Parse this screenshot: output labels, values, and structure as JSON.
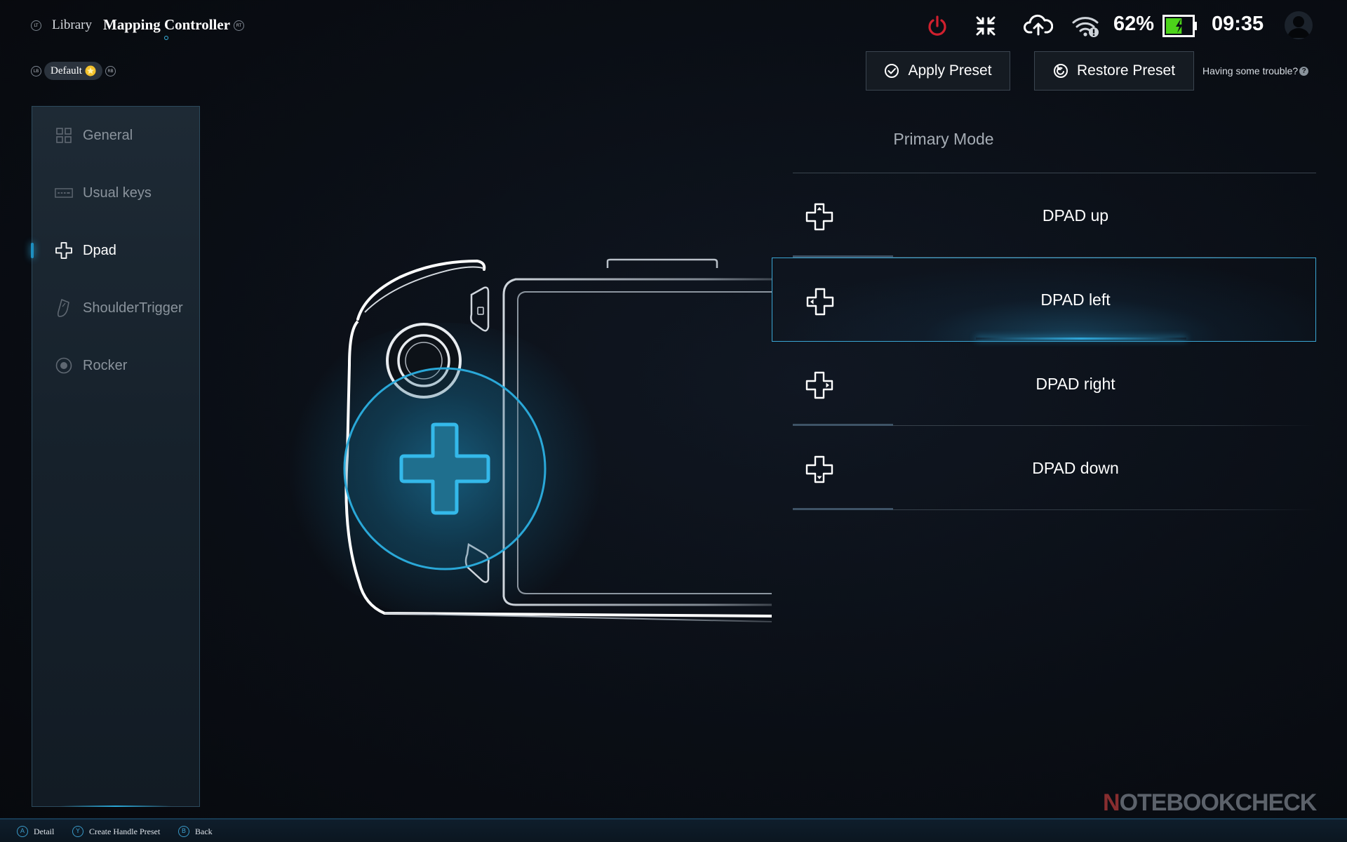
{
  "header": {
    "lt_badge": "LT",
    "rt_badge": "RT",
    "library_label": "Library",
    "title": "Mapping Controller",
    "battery_percent": "62%",
    "battery_level": 0.62,
    "clock": "09:35",
    "colors": {
      "power": "#d0202e",
      "battery_fill": "#4cd31a",
      "accent": "#2aa8d8"
    }
  },
  "preset": {
    "lb_badge": "LB",
    "rb_badge": "RB",
    "name": "Default",
    "apply_label": "Apply Preset",
    "restore_label": "Restore Preset",
    "trouble_text": "Having some trouble?",
    "help_glyph": "?"
  },
  "sidebar": {
    "items": [
      {
        "label": "General",
        "icon": "grid-icon",
        "active": false
      },
      {
        "label": "Usual keys",
        "icon": "keyboard-icon",
        "active": false
      },
      {
        "label": "Dpad",
        "icon": "dpad-icon",
        "active": true
      },
      {
        "label": "ShoulderTrigger",
        "icon": "trigger-icon",
        "active": false
      },
      {
        "label": "Rocker",
        "icon": "joystick-icon",
        "active": false
      }
    ]
  },
  "mapping": {
    "mode_title": "Primary Mode",
    "rows": [
      {
        "label": "DPAD up",
        "selected": false
      },
      {
        "label": "DPAD left",
        "selected": true
      },
      {
        "label": "DPAD right",
        "selected": false
      },
      {
        "label": "DPAD down",
        "selected": false
      }
    ]
  },
  "footer": {
    "hints": [
      {
        "button": "A",
        "label": "Detail"
      },
      {
        "button": "Y",
        "label": "Create Handle Preset"
      },
      {
        "button": "B",
        "label": "Back"
      }
    ]
  },
  "watermark": {
    "prefix": "N",
    "rest": "OTEBOOKCHECK"
  }
}
